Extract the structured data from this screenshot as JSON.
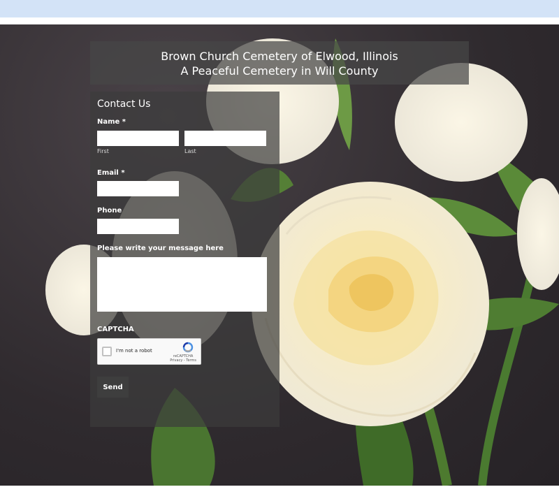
{
  "header": {
    "title": "Brown Church Cemetery of Elwood, Illinois",
    "subtitle": "A Peaceful Cemetery in Will County"
  },
  "form": {
    "title": "Contact Us",
    "name_label": "Name *",
    "first_sublabel": "First",
    "last_sublabel": "Last",
    "email_label": "Email *",
    "phone_label": "Phone",
    "message_label": "Please write your message here",
    "captcha_label": "CAPTCHA",
    "captcha_checkbox_text": "I'm not a robot",
    "captcha_brand": "reCAPTCHA",
    "captcha_links": "Privacy - Terms",
    "send_label": "Send"
  },
  "icons": {
    "captcha_logo": "recaptcha-icon"
  },
  "colors": {
    "topbar": "#d3e3f7",
    "panel": "#464646"
  }
}
